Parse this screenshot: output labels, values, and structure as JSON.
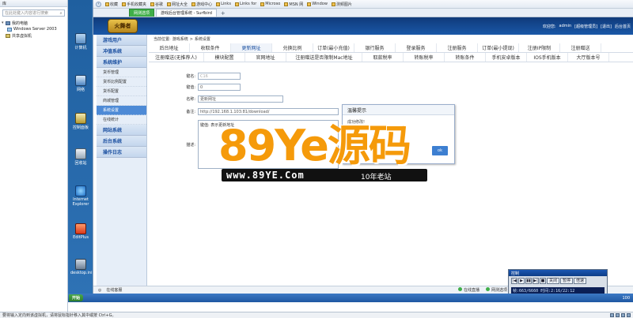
{
  "host": {
    "panel_title": "库",
    "search_placeholder": "在此处键入内容进行搜索",
    "tree": [
      {
        "label": "我的电脑",
        "level": 0
      },
      {
        "label": "Windows Server 2003",
        "level": 1
      },
      {
        "label": "共享虚拟机",
        "level": 0
      }
    ],
    "status_text": "要将输入定向到该虚拟机，请将鼠标指针移入其中或按 Ctrl+G。"
  },
  "desktop": {
    "icons": [
      {
        "label": "计算机",
        "icon": "computer-icon"
      },
      {
        "label": "网络",
        "icon": "network-icon"
      },
      {
        "label": "控制面板",
        "icon": "control-panel-icon"
      },
      {
        "label": "回收站",
        "icon": "recycle-bin-icon"
      },
      {
        "label": "Internet Explorer",
        "icon": "ie-icon"
      },
      {
        "label": "EditPlus",
        "icon": "editplus-icon"
      },
      {
        "label": "desktop.ini",
        "icon": "desktop-ini-icon"
      }
    ]
  },
  "browser": {
    "favorites": [
      "收藏",
      "手机收藏夹",
      "谷歌",
      "网址大全",
      "游戏中心",
      "Links",
      "Links for",
      "Microso",
      "MSN 网",
      "Window",
      "测频图片"
    ],
    "tabs": [
      {
        "label": "网测选项",
        "state": "green"
      },
      {
        "label": "游戏后台管理系统 - Surfbird",
        "state": "active"
      }
    ],
    "tab_add": "+"
  },
  "admin": {
    "logo_text": "火舞者",
    "header_links": [
      "欢迎您:",
      "admin",
      "[超级管理员]",
      "[退出]",
      "后台首页"
    ],
    "sidebar": [
      {
        "label": "游戏用户",
        "type": "section"
      },
      {
        "label": "冲值系统",
        "type": "section"
      },
      {
        "label": "系统维护",
        "type": "section"
      },
      {
        "label": "货币管理",
        "type": "item"
      },
      {
        "label": "货币比例配置",
        "type": "item"
      },
      {
        "label": "货币配置",
        "type": "item"
      },
      {
        "label": "商城管理",
        "type": "item"
      },
      {
        "label": "系统设置",
        "type": "item",
        "active": true
      },
      {
        "label": "在线统计",
        "type": "item"
      },
      {
        "label": "网站系统",
        "type": "section"
      },
      {
        "label": "后台系统",
        "type": "section"
      },
      {
        "label": "操作日志",
        "type": "section"
      }
    ],
    "breadcrumb": [
      "当前位置:",
      "游戏系统",
      ">",
      "系统设置"
    ],
    "tabs_row1": [
      "后台地址",
      "收取条件",
      "更新网址",
      "兑换比例",
      "订单(最小充值)",
      "银行服务",
      "登录服务",
      "注册服务",
      "订单(最小提现)",
      "注册IP限制",
      "注册赠送"
    ],
    "tabs_row2": [
      "注册赠送(无推荐人)",
      "模块配置",
      "官网地址",
      "注册赠送是否限制Mac地址",
      "取款税率",
      "转账税率",
      "转账条件",
      "手机安卓版本",
      "IOS手机版本",
      "大厅版本号"
    ],
    "active_tab": "更新网址",
    "form": {
      "row1_label": "键名:",
      "row1_value": "C16",
      "row2_label": "键值:",
      "row2_value": "0",
      "name_label": "名称:",
      "name_value": "更新网址",
      "remark_label": "备注:",
      "remark_value": "http://192.168.1.103:81/download/",
      "desc_label": "描述:",
      "desc_value": "键值: 表示更新地址"
    },
    "dialog": {
      "title": "温馨提示",
      "body": "成功修改!",
      "ok": "ok"
    },
    "status_left": "在线客服",
    "status_right": [
      "在线直播",
      "网测选项"
    ]
  },
  "watermark": {
    "big": "89Ye源码",
    "url": "www.89YE.Com",
    "tag": "10年老站"
  },
  "control": {
    "title": "控制",
    "info": "帧:663/6660 时间:2:16/22:12",
    "buttons": [
      "|◀",
      "▶",
      "▮▮",
      "▶|",
      "■",
      "关闭",
      "暂停",
      "倍速"
    ],
    "progress": 0.1
  },
  "taskbar": {
    "start": "开始",
    "clock": "100"
  }
}
